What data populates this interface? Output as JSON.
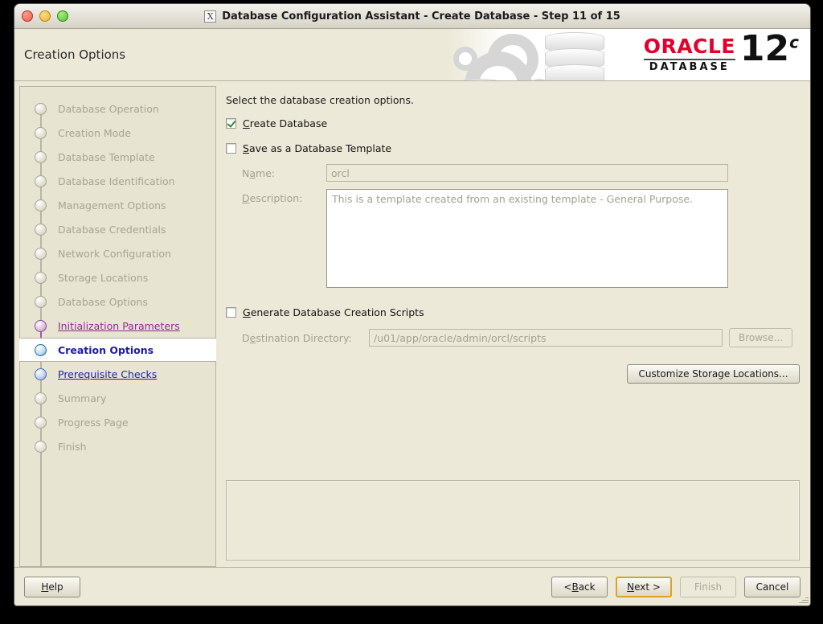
{
  "window": {
    "title": "Database Configuration Assistant - Create Database - Step 11 of 15",
    "app_icon": "X",
    "banner_title": "Creation Options"
  },
  "branding": {
    "oracle_word": "ORACLE",
    "database_word": "DATABASE",
    "version_number": "12",
    "version_suffix": "c",
    "oracle_red": "#e4002b"
  },
  "sidebar": {
    "steps": [
      {
        "label": "Database Operation",
        "state": "done"
      },
      {
        "label": "Creation Mode",
        "state": "done"
      },
      {
        "label": "Database Template",
        "state": "done"
      },
      {
        "label": "Database Identification",
        "state": "done"
      },
      {
        "label": "Management Options",
        "state": "done"
      },
      {
        "label": "Database Credentials",
        "state": "done"
      },
      {
        "label": "Network Configuration",
        "state": "done"
      },
      {
        "label": "Storage Locations",
        "state": "done"
      },
      {
        "label": "Database Options",
        "state": "done"
      },
      {
        "label": "Initialization Parameters",
        "state": "visited"
      },
      {
        "label": "Creation Options",
        "state": "current"
      },
      {
        "label": "Prerequisite Checks",
        "state": "upcoming-link"
      },
      {
        "label": "Summary",
        "state": "done"
      },
      {
        "label": "Progress Page",
        "state": "done"
      },
      {
        "label": "Finish",
        "state": "done"
      }
    ]
  },
  "main": {
    "intro": "Select the database creation options.",
    "create_database": {
      "label": "Create Database",
      "checked": true
    },
    "save_as_template": {
      "label": "Save as a Database Template",
      "checked": false
    },
    "name_field": {
      "label": "Name:",
      "value": "orcl"
    },
    "description_field": {
      "label": "Description:",
      "value": "This is a template created from an existing template - General Purpose."
    },
    "generate_scripts": {
      "label": "Generate Database Creation Scripts",
      "checked": false
    },
    "destination_directory": {
      "label": "Destination Directory:",
      "value": "/u01/app/oracle/admin/orcl/scripts"
    },
    "browse_button": "Browse...",
    "customize_storage_button": "Customize Storage Locations...",
    "message_panel": ""
  },
  "footer": {
    "help": "Help",
    "back": "< Back",
    "next": "Next >",
    "finish": "Finish",
    "cancel": "Cancel"
  }
}
